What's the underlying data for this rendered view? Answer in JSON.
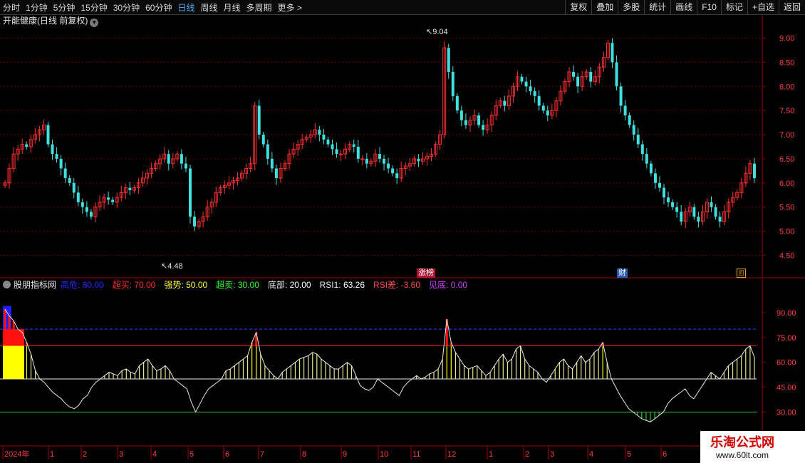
{
  "toolbar": {
    "periods": [
      "分时",
      "1分钟",
      "5分钟",
      "15分钟",
      "30分钟",
      "60分钟",
      "日线",
      "周线",
      "月线",
      "多周期",
      "更多 >"
    ],
    "active_period": "日线",
    "actions": [
      "复权",
      "叠加",
      "多股",
      "统计",
      "画线",
      "F10",
      "标记",
      "+自选",
      "返回"
    ]
  },
  "stock": {
    "title": "开能健康(日线 前复权)",
    "high_note": "9.04",
    "low_note": "4.48"
  },
  "price_axis": [
    "9.00",
    "8.50",
    "8.00",
    "7.50",
    "7.00",
    "6.50",
    "6.00",
    "5.50",
    "5.00",
    "4.50"
  ],
  "event_markers": {
    "zhangting": "涨榜",
    "cai": "财",
    "hui": "回"
  },
  "indicator": {
    "circle": "",
    "name": "股朋指标网",
    "params": [
      {
        "label": "高危:",
        "value": "80.00",
        "color": "#2b2bff"
      },
      {
        "label": "超买:",
        "value": "70.00",
        "color": "#ff3030"
      },
      {
        "label": "强势:",
        "value": "50.00",
        "color": "#ffff40"
      },
      {
        "label": "超卖:",
        "value": "30.00",
        "color": "#30ff30"
      },
      {
        "label": "底部:",
        "value": "20.00",
        "color": "#ffffff"
      },
      {
        "label": "RSI1:",
        "value": "63.26",
        "color": "#ffffff"
      },
      {
        "label": "RSI差:",
        "value": "-3.60",
        "color": "#ff5050"
      },
      {
        "label": "见底:",
        "value": "0.00",
        "color": "#d040ff"
      }
    ]
  },
  "indicator_axis": [
    "90.00",
    "75.00",
    "60.00",
    "45.00",
    "30.00"
  ],
  "date_axis": [
    "2024年",
    "1",
    "2",
    "3",
    "4",
    "5",
    "6",
    "7",
    "8",
    "9",
    "10",
    "11",
    "12",
    "1",
    "2",
    "3",
    "4",
    "5",
    "6"
  ],
  "watermark": {
    "title": "乐淘公式网",
    "url": "www.60lt.com"
  },
  "colors": {
    "up": "#ff3030",
    "down": "#40e0e0",
    "grid": "#8a0000",
    "accent": "#4fb3ff"
  },
  "chart_data": {
    "type": "line",
    "ylim": [
      4.3,
      9.2
    ],
    "price_series": [
      6.0,
      6.3,
      6.6,
      6.7,
      6.8,
      6.75,
      6.9,
      7.0,
      7.1,
      7.2,
      6.8,
      6.6,
      6.5,
      6.3,
      6.1,
      6.0,
      5.8,
      5.6,
      5.5,
      5.4,
      5.3,
      5.5,
      5.6,
      5.7,
      5.65,
      5.6,
      5.7,
      5.8,
      5.9,
      5.85,
      5.9,
      6.0,
      6.1,
      6.2,
      6.3,
      6.4,
      6.5,
      6.6,
      6.4,
      6.5,
      6.6,
      6.4,
      6.3,
      5.3,
      5.1,
      5.2,
      5.3,
      5.5,
      5.6,
      5.8,
      5.9,
      5.95,
      6.0,
      6.05,
      6.1,
      6.2,
      6.3,
      6.4,
      7.6,
      7.0,
      6.8,
      6.5,
      6.3,
      6.1,
      6.3,
      6.4,
      6.6,
      6.7,
      6.8,
      6.9,
      6.95,
      7.0,
      7.1,
      7.0,
      6.9,
      6.8,
      6.7,
      6.6,
      6.6,
      6.7,
      6.8,
      6.75,
      6.5,
      6.5,
      6.4,
      6.45,
      6.6,
      6.5,
      6.4,
      6.3,
      6.2,
      6.1,
      6.3,
      6.35,
      6.4,
      6.5,
      6.45,
      6.5,
      6.55,
      6.6,
      6.8,
      7.0,
      8.8,
      8.3,
      7.8,
      7.5,
      7.3,
      7.2,
      7.3,
      7.4,
      7.2,
      7.1,
      7.2,
      7.4,
      7.6,
      7.7,
      7.6,
      7.8,
      8.0,
      8.2,
      8.1,
      8.0,
      7.9,
      7.8,
      7.6,
      7.5,
      7.4,
      7.5,
      7.7,
      7.9,
      8.1,
      8.3,
      8.2,
      8.0,
      8.2,
      8.3,
      8.1,
      8.2,
      8.4,
      8.6,
      8.9,
      8.5,
      8.0,
      7.6,
      7.4,
      7.2,
      7.0,
      6.8,
      6.6,
      6.4,
      6.2,
      6.0,
      5.9,
      5.7,
      5.6,
      5.5,
      5.4,
      5.2,
      5.4,
      5.5,
      5.3,
      5.2,
      5.4,
      5.6,
      5.5,
      5.3,
      5.2,
      5.4,
      5.6,
      5.7,
      5.8,
      6.0,
      6.2,
      6.4,
      6.1
    ],
    "rsi_series": [
      92,
      88,
      85,
      80,
      78,
      72,
      65,
      55,
      50,
      48,
      45,
      42,
      40,
      38,
      35,
      33,
      32,
      34,
      38,
      40,
      45,
      48,
      50,
      52,
      54,
      53,
      52,
      55,
      56,
      54,
      53,
      58,
      60,
      62,
      58,
      55,
      56,
      58,
      55,
      50,
      48,
      46,
      44,
      36,
      30,
      35,
      40,
      44,
      46,
      48,
      50,
      55,
      56,
      58,
      60,
      62,
      64,
      72,
      78,
      65,
      58,
      55,
      52,
      50,
      54,
      56,
      58,
      60,
      62,
      63,
      64,
      66,
      65,
      62,
      60,
      58,
      56,
      56,
      58,
      60,
      58,
      52,
      46,
      44,
      43,
      45,
      50,
      48,
      46,
      44,
      42,
      40,
      45,
      48,
      50,
      52,
      50,
      51,
      53,
      54,
      56,
      62,
      86,
      72,
      66,
      62,
      58,
      56,
      57,
      58,
      55,
      52,
      54,
      58,
      62,
      65,
      60,
      62,
      68,
      70,
      62,
      58,
      56,
      54,
      50,
      48,
      52,
      56,
      60,
      62,
      58,
      56,
      60,
      64,
      60,
      62,
      66,
      68,
      72,
      60,
      50,
      45,
      40,
      36,
      32,
      30,
      28,
      26,
      25,
      24,
      26,
      28,
      30,
      35,
      38,
      40,
      42,
      44,
      40,
      38,
      42,
      46,
      50,
      54,
      52,
      50,
      54,
      58,
      60,
      62,
      64,
      68,
      70,
      63
    ],
    "levels": {
      "gaowei": 80,
      "chaomai": 70,
      "qiangshi": 50,
      "chaomai_low": 30,
      "dibu": 20
    }
  }
}
